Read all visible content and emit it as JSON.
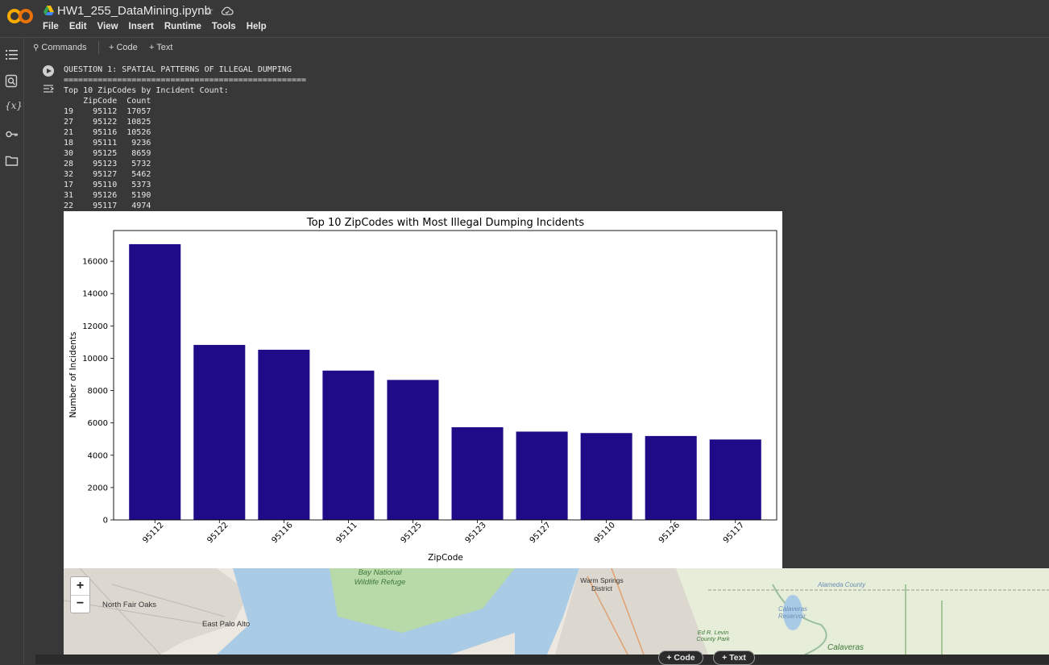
{
  "header": {
    "title": "HW1_255_DataMining.ipynb",
    "menu": [
      "File",
      "Edit",
      "View",
      "Insert",
      "Runtime",
      "Tools",
      "Help"
    ]
  },
  "toolbar": {
    "commands_label": "Commands",
    "code_label": "+ Code",
    "text_label": "+ Text"
  },
  "output": {
    "lines": [
      "QUESTION 1: SPATIAL PATTERNS OF ILLEGAL DUMPING",
      "==================================================",
      "Top 10 ZipCodes by Incident Count:",
      "    ZipCode  Count",
      "19    95112  17057",
      "27    95122  10825",
      "21    95116  10526",
      "18    95111   9236",
      "30    95125   8659",
      "28    95123   5732",
      "32    95127   5462",
      "17    95110   5373",
      "31    95126   5190",
      "22    95117   4974"
    ]
  },
  "chart_data": {
    "type": "bar",
    "title": "Top 10 ZipCodes with Most Illegal Dumping Incidents",
    "xlabel": "ZipCode",
    "ylabel": "Number of Incidents",
    "categories": [
      "95112",
      "95122",
      "95116",
      "95111",
      "95125",
      "95123",
      "95127",
      "95110",
      "95126",
      "95117"
    ],
    "values": [
      17057,
      10825,
      10526,
      9236,
      8659,
      5732,
      5462,
      5373,
      5190,
      4974
    ],
    "ylim": [
      0,
      17900
    ],
    "yticks": [
      0,
      2000,
      4000,
      6000,
      8000,
      10000,
      12000,
      14000,
      16000
    ],
    "bar_color": "#1f0a87",
    "grid": false
  },
  "map": {
    "zoom_in": "+",
    "zoom_out": "−",
    "labels": {
      "north_fair_oaks": "North Fair Oaks",
      "east_palo_alto": "East Palo Alto",
      "refuge": "Bay National Wildlife Refuge",
      "warm_springs": "Warm Springs District",
      "alameda_county": "Alameda County",
      "ed_levin": "Ed R. Levin County Park",
      "calaveras": "Calaveras",
      "calaveras_reservoir": "Calaveras Reservoir"
    }
  },
  "footer": {
    "code_label": "+ Code",
    "text_label": "+ Text"
  }
}
